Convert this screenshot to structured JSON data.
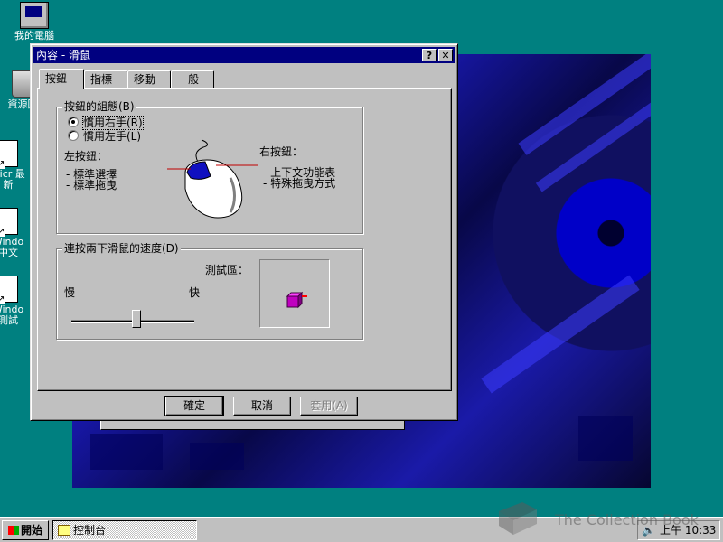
{
  "desktop": {
    "icons": [
      {
        "label": "我的電腦",
        "icon": "my-computer-icon"
      },
      {
        "label": "資源回",
        "icon": "recycle-bin-icon"
      },
      {
        "label": "Micr 最新",
        "icon": "shortcut-icon"
      },
      {
        "label": "Windo 中文",
        "icon": "shortcut-icon"
      },
      {
        "label": "Windo 測試",
        "icon": "shortcut-icon"
      }
    ]
  },
  "dialog": {
    "title": "內容 - 滑鼠",
    "title_buttons": {
      "help": "?",
      "close": "✕"
    },
    "tabs": [
      "按鈕",
      "指標",
      "移動",
      "一般"
    ],
    "active_tab": 0,
    "button_config": {
      "group_label": "按鈕的組態(B)",
      "options": [
        "慣用右手(R)",
        "慣用左手(L)"
      ],
      "selected": 0,
      "left_button_heading": "左按鈕：",
      "left_button_items": [
        "- 標準選擇",
        "- 標準拖曳"
      ],
      "right_button_heading": "右按鈕：",
      "right_button_items": [
        "- 上下文功能表",
        "- 特殊拖曳方式"
      ]
    },
    "double_click": {
      "group_label": "連按兩下滑鼠的速度(D)",
      "slow_label": "慢",
      "fast_label": "快",
      "test_area_label": "測試區：",
      "speed_level": 0.53
    },
    "buttons": {
      "ok": "確定",
      "cancel": "取消",
      "apply": "套用(A)"
    }
  },
  "taskbar": {
    "start_label": "開始",
    "task_label": "控制台",
    "clock": "上午 10:33"
  },
  "watermark": "The Collection Book",
  "colors": {
    "desktop": "#008080",
    "titlebar": "#000080",
    "face": "#c0c0c0"
  }
}
